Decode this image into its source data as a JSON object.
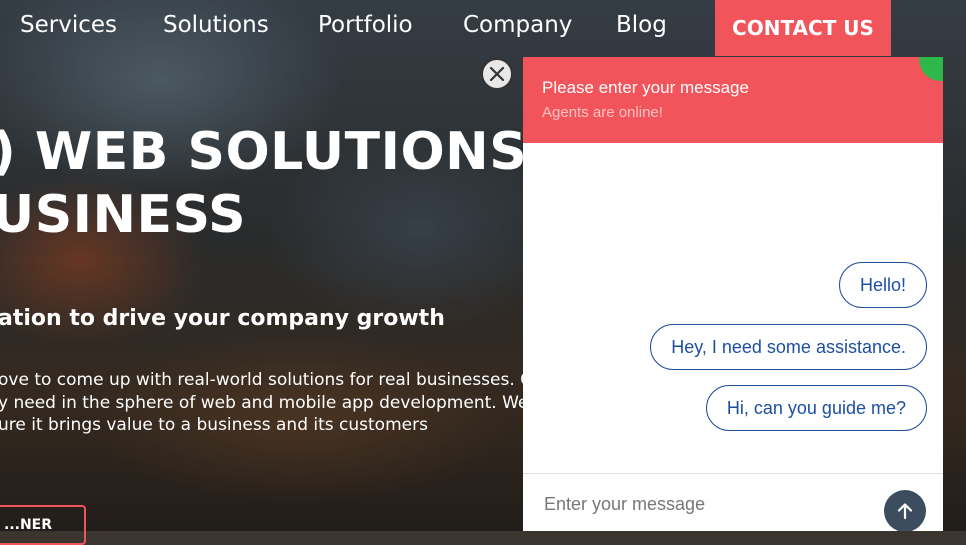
{
  "nav": {
    "items": [
      "Services",
      "Solutions",
      "Portfolio",
      "Company",
      "Blog"
    ],
    "contact_label": "CONTACT US"
  },
  "hero": {
    "title_line1": ") WEB SOLUTIONS",
    "title_line2": "USINESS",
    "subtitle": "ation to drive your company growth",
    "body_line1": "ove to come up with real-world solutions for real businesses. O",
    "body_line2": "y need in the sphere of web and mobile app development. We n",
    "body_line3": "ure it brings value to a business and its customers",
    "cta_label": "...NER"
  },
  "chat": {
    "header_title": "Please enter your message",
    "header_status": "Agents are online!",
    "messages": [
      "Hello!",
      "Hey, I need some assistance.",
      "Hi, can you guide me?"
    ],
    "input_placeholder": "Enter your message",
    "accent_color": "#f2545b",
    "bubble_color": "#1e4fa0",
    "online_color": "#2fb84a"
  },
  "icons": {
    "close": "close-icon",
    "send": "arrow-up-icon"
  }
}
